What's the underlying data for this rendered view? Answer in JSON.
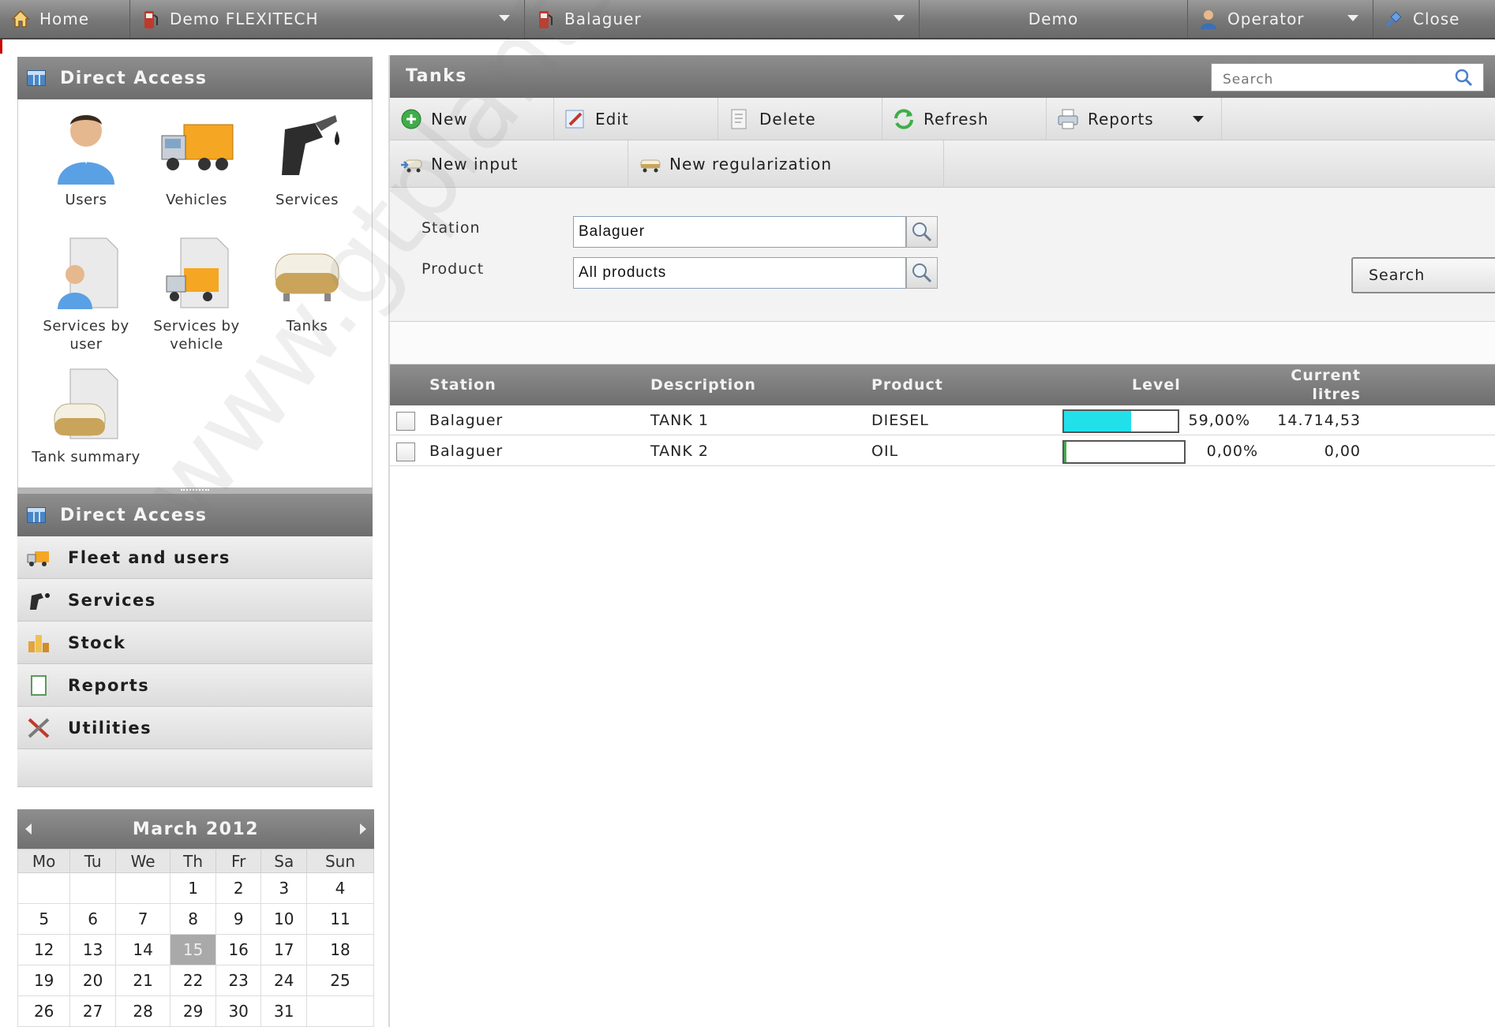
{
  "topbar": {
    "home": "Home",
    "company": "Demo FLEXITECH",
    "station": "Balaguer",
    "user": "Demo",
    "role": "Operator",
    "close": "Close"
  },
  "direct_access": {
    "title": "Direct Access",
    "items": [
      {
        "label": "Users",
        "icon": "user-icon"
      },
      {
        "label": "Vehicles",
        "icon": "truck-icon"
      },
      {
        "label": "Services",
        "icon": "fuel-nozzle-icon"
      },
      {
        "label": "Services by user",
        "icon": "user-document-icon"
      },
      {
        "label": "Services by vehicle",
        "icon": "truck-document-icon"
      },
      {
        "label": "Tanks",
        "icon": "tank-icon"
      },
      {
        "label": "Tank summary",
        "icon": "tank-document-icon"
      }
    ]
  },
  "menu": {
    "items": [
      {
        "label": "Direct Access",
        "icon": "grid-icon"
      },
      {
        "label": "Fleet and users",
        "icon": "truck-icon"
      },
      {
        "label": "Services",
        "icon": "fuel-nozzle-icon"
      },
      {
        "label": "Stock",
        "icon": "stock-icon"
      },
      {
        "label": "Reports",
        "icon": "report-icon"
      },
      {
        "label": "Utilities",
        "icon": "tools-icon"
      }
    ]
  },
  "calendar": {
    "title": "March 2012",
    "weekdays": [
      "Mo",
      "Tu",
      "We",
      "Th",
      "Fr",
      "Sa",
      "Sun"
    ],
    "weeks": [
      [
        "",
        "",
        "",
        "1",
        "2",
        "3",
        "4"
      ],
      [
        "5",
        "6",
        "7",
        "8",
        "9",
        "10",
        "11"
      ],
      [
        "12",
        "13",
        "14",
        "15",
        "16",
        "17",
        "18"
      ],
      [
        "19",
        "20",
        "21",
        "22",
        "23",
        "24",
        "25"
      ],
      [
        "26",
        "27",
        "28",
        "29",
        "30",
        "31",
        ""
      ]
    ],
    "today": "15"
  },
  "main": {
    "title": "Tanks",
    "search_placeholder": "Search",
    "toolbar": {
      "new": "New",
      "edit": "Edit",
      "delete": "Delete",
      "refresh": "Refresh",
      "reports": "Reports",
      "new_input": "New input",
      "new_regularization": "New regularization"
    },
    "filters": {
      "station_label": "Station",
      "station_value": "Balaguer",
      "product_label": "Product",
      "product_value": "All products",
      "search_button": "Search"
    },
    "grid": {
      "headers": {
        "station": "Station",
        "description": "Description",
        "product": "Product",
        "level": "Level",
        "current_litres_1": "Current",
        "current_litres_2": "litres"
      },
      "rows": [
        {
          "station": "Balaguer",
          "description": "TANK 1",
          "product": "DIESEL",
          "level_text": "59,00%",
          "level": 0.59,
          "litres": "14.714,53"
        },
        {
          "station": "Balaguer",
          "description": "TANK 2",
          "product": "OIL",
          "level_text": "0,00%",
          "level": 0.0,
          "litres": "0,00"
        }
      ]
    }
  },
  "watermark": "www.gtplantspares.com",
  "colors": {
    "header_gray": "#7a7a7a",
    "level_fill": "#22e0ea",
    "today": "#a9a9a9"
  }
}
